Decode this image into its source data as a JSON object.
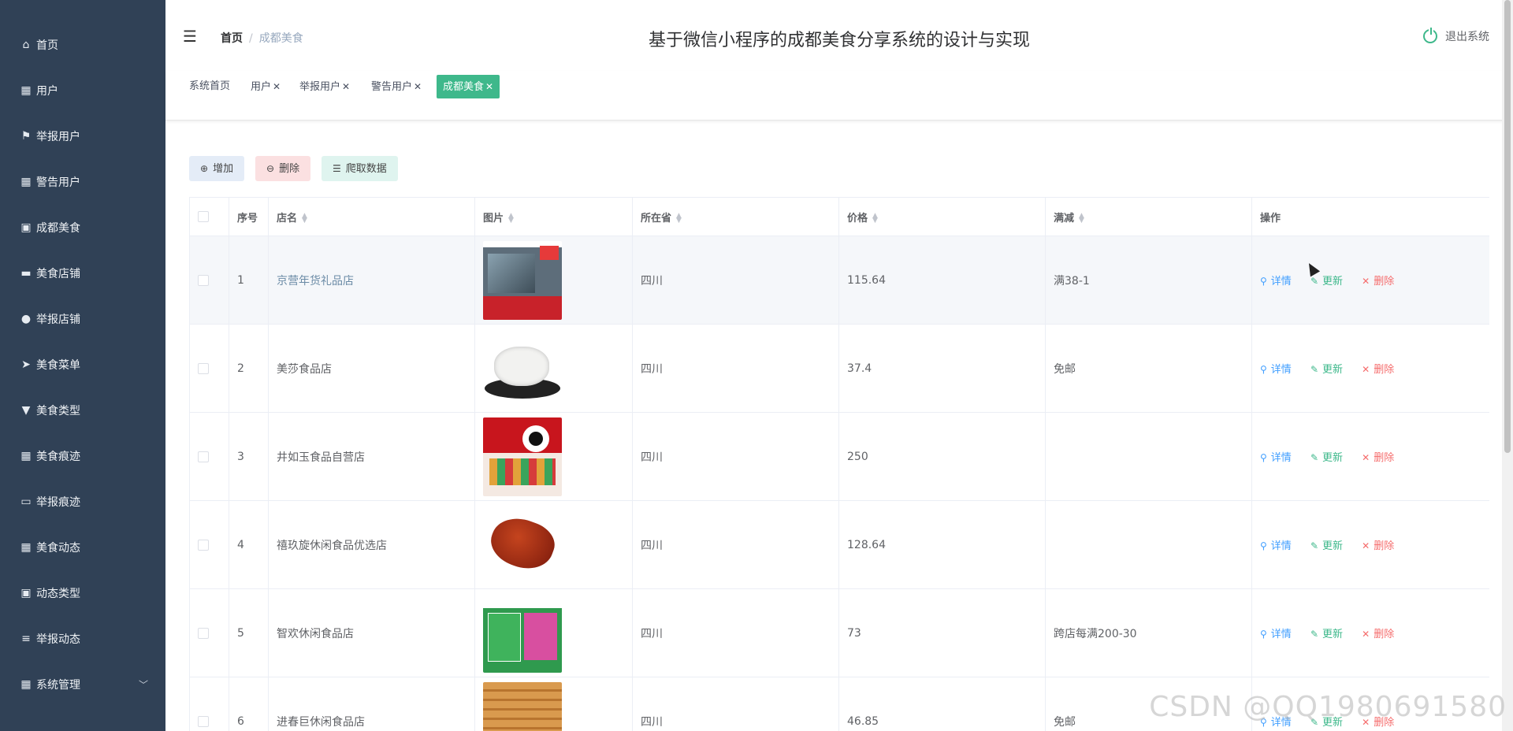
{
  "sidebar": {
    "items": [
      {
        "icon": "home-icon",
        "glyph": "⌂",
        "label": "首页"
      },
      {
        "icon": "grid-icon",
        "glyph": "▦",
        "label": "用户"
      },
      {
        "icon": "flag-icon",
        "glyph": "⚑",
        "label": "举报用户"
      },
      {
        "icon": "grid-icon",
        "glyph": "▦",
        "label": "警告用户"
      },
      {
        "icon": "clipboard-icon",
        "glyph": "▣",
        "label": "成都美食"
      },
      {
        "icon": "monitor-icon",
        "glyph": "▬",
        "label": "美食店铺"
      },
      {
        "icon": "user-icon",
        "glyph": "●",
        "label": "举报店铺"
      },
      {
        "icon": "send-icon",
        "glyph": "➤",
        "label": "美食菜单"
      },
      {
        "icon": "sign-icon",
        "glyph": "▼",
        "label": "美食类型"
      },
      {
        "icon": "grid-icon",
        "glyph": "▦",
        "label": "美食痕迹"
      },
      {
        "icon": "ticket-icon",
        "glyph": "▭",
        "label": "举报痕迹"
      },
      {
        "icon": "grid-icon",
        "glyph": "▦",
        "label": "美食动态"
      },
      {
        "icon": "clipboard-icon",
        "glyph": "▣",
        "label": "动态类型"
      },
      {
        "icon": "sliders-icon",
        "glyph": "≡",
        "label": "举报动态"
      },
      {
        "icon": "grid-icon",
        "glyph": "▦",
        "label": "系统管理"
      }
    ]
  },
  "header": {
    "breadcrumb_home": "首页",
    "breadcrumb_current": "成都美食",
    "title": "基于微信小程序的成都美食分享系统的设计与实现",
    "logout": "退出系统"
  },
  "tags": [
    {
      "label": "系统首页",
      "closable": false
    },
    {
      "label": "用户",
      "closable": true
    },
    {
      "label": "举报用户",
      "closable": true
    },
    {
      "label": "警告用户",
      "closable": true
    },
    {
      "label": "成都美食",
      "closable": true,
      "active": true
    }
  ],
  "toolbar": {
    "add": "增加",
    "delete": "删除",
    "crawl": "爬取数据"
  },
  "table": {
    "headers": {
      "index": "序号",
      "shop": "店名",
      "image": "图片",
      "province": "所在省",
      "price": "价格",
      "discount": "满减",
      "actions": "操作"
    },
    "action_labels": {
      "detail": "详情",
      "update": "更新",
      "delete": "删除"
    },
    "rows": [
      {
        "index": "1",
        "shop": "京营年货礼品店",
        "province": "四川",
        "price": "115.64",
        "discount": "满38-1"
      },
      {
        "index": "2",
        "shop": "美莎食品店",
        "province": "四川",
        "price": "37.4",
        "discount": "免邮"
      },
      {
        "index": "3",
        "shop": "井如玉食品自营店",
        "province": "四川",
        "price": "250",
        "discount": ""
      },
      {
        "index": "4",
        "shop": "禧玖旋休闲食品优选店",
        "province": "四川",
        "price": "128.64",
        "discount": ""
      },
      {
        "index": "5",
        "shop": "智欢休闲食品店",
        "province": "四川",
        "price": "73",
        "discount": "跨店每满200-30"
      },
      {
        "index": "6",
        "shop": "进春巨休闲食品店",
        "province": "四川",
        "price": "46.85",
        "discount": "免邮"
      }
    ]
  },
  "watermark": "CSDN @QQ1980691580",
  "colors": {
    "sidebar": "#304156",
    "accent": "#3eb88b",
    "detail": "#409eff",
    "danger": "#f56c6c"
  }
}
